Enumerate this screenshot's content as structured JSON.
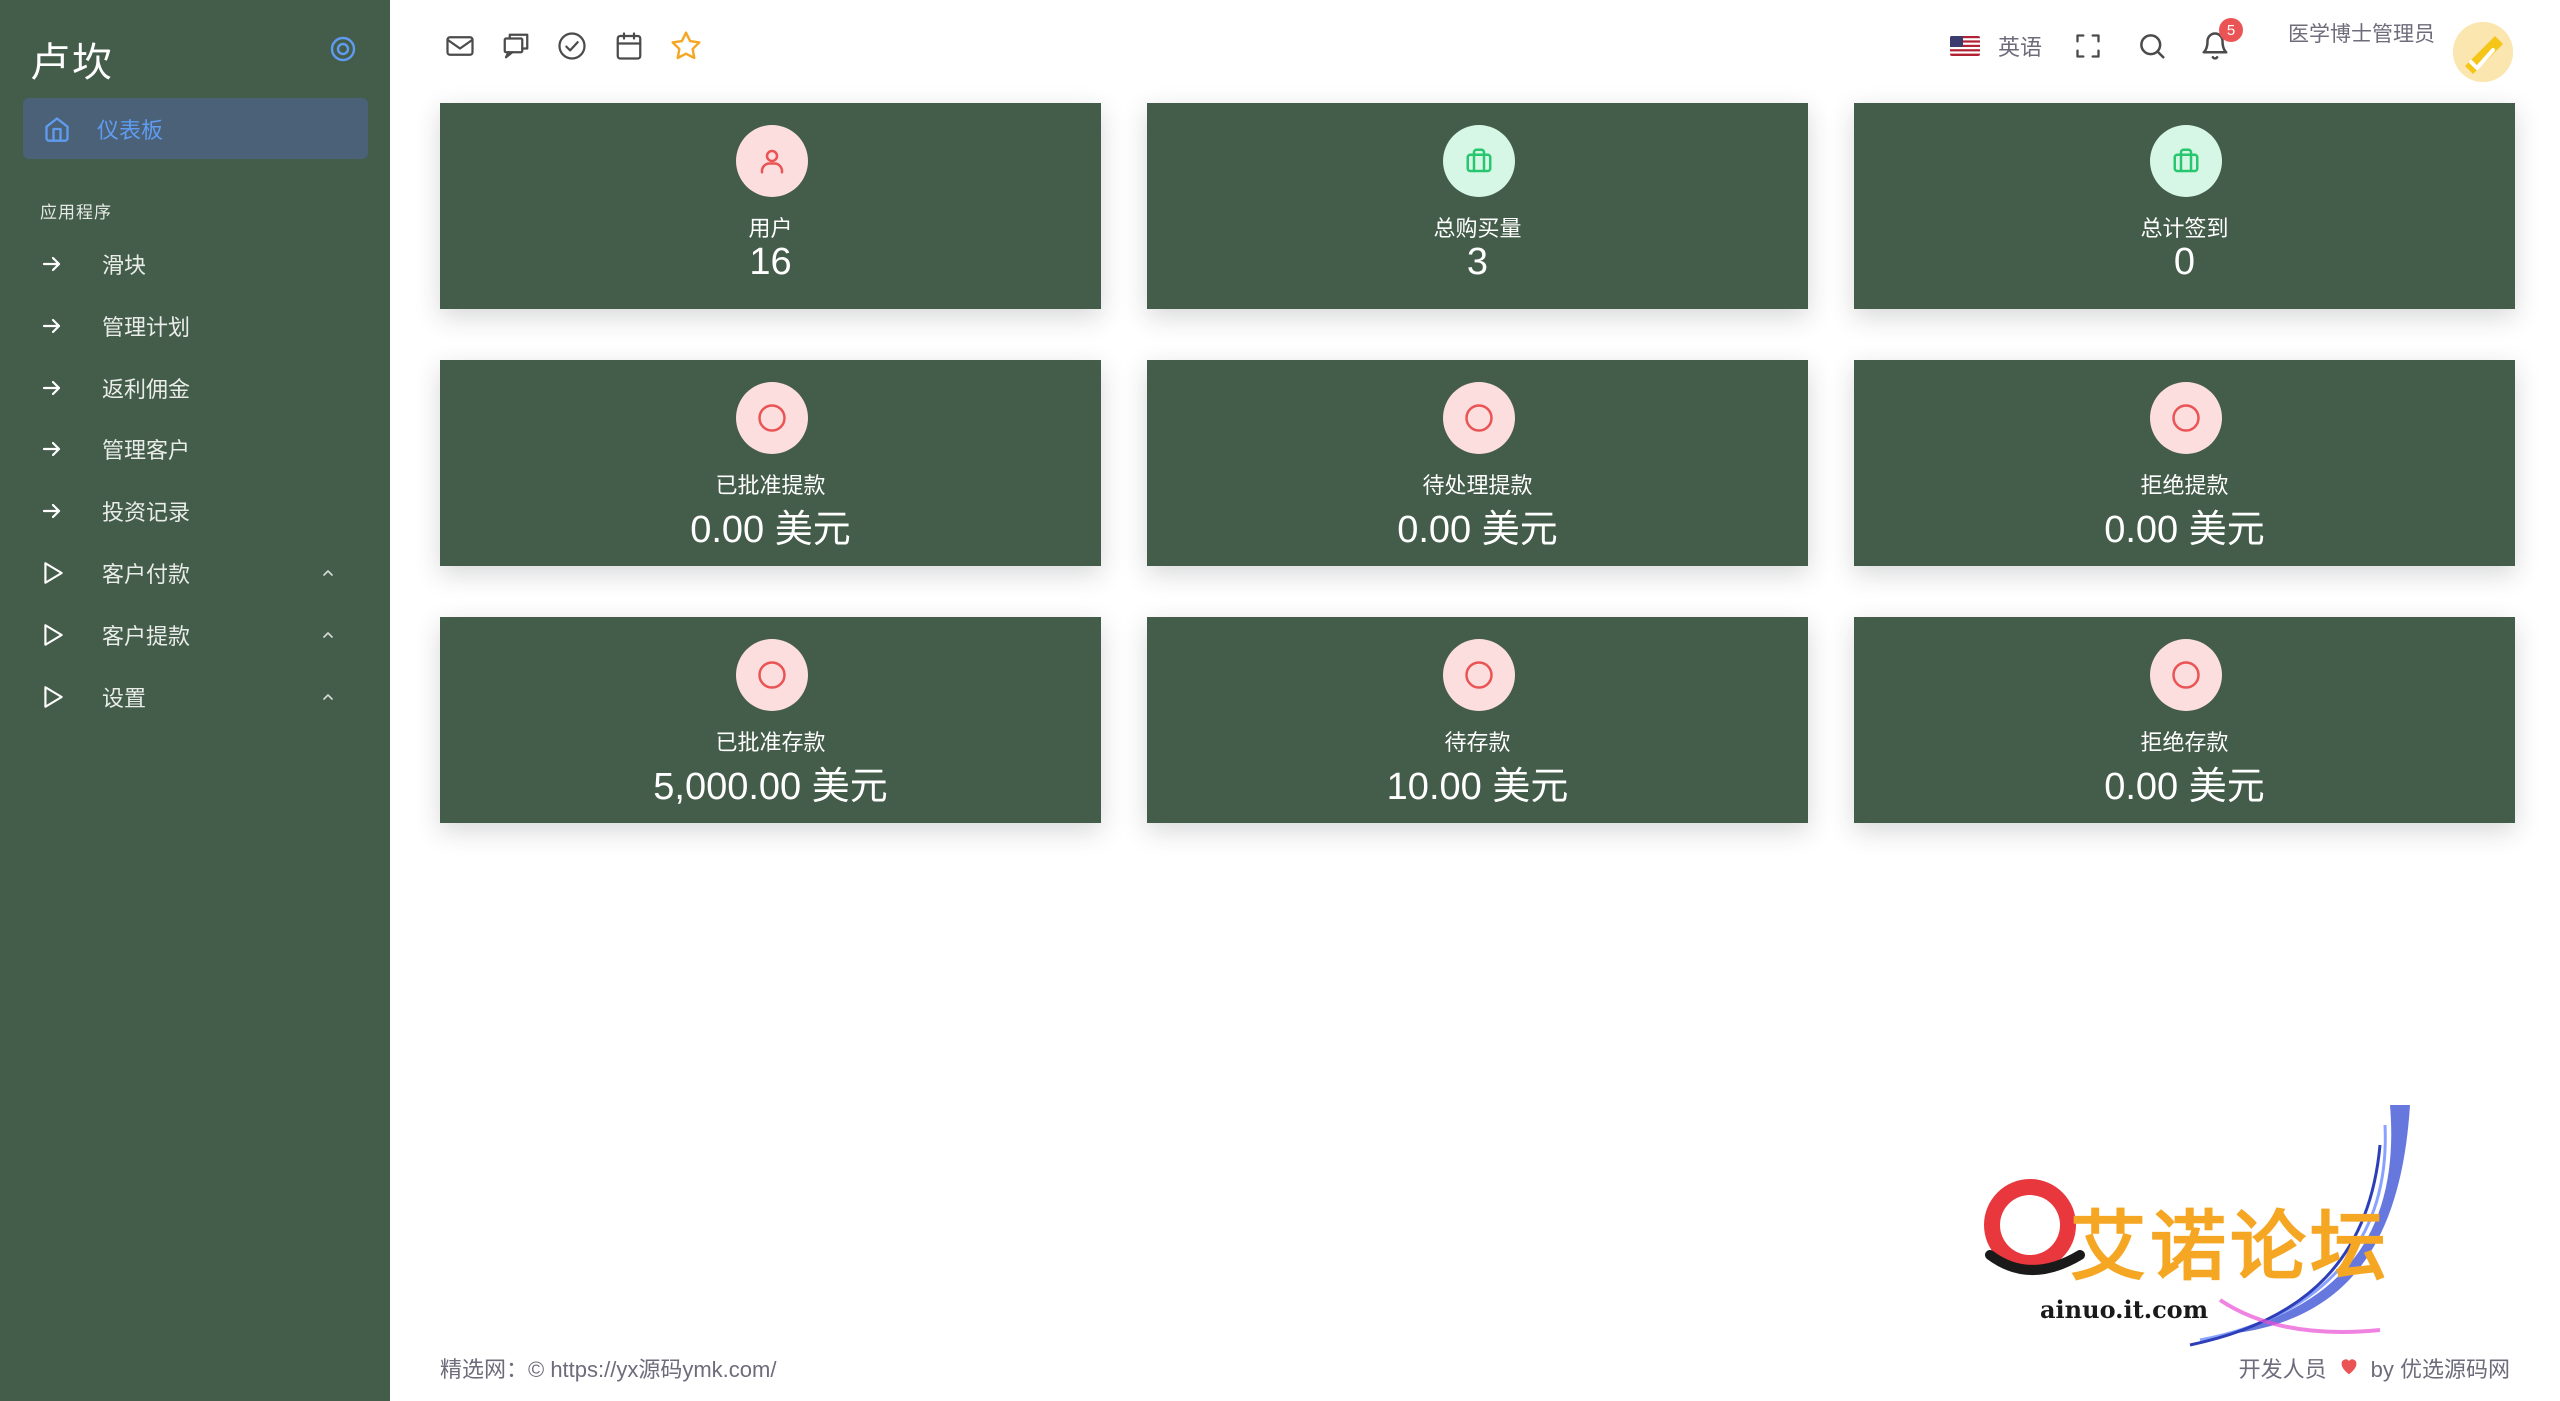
{
  "sidebar": {
    "brand": "卢坎",
    "active_item": "仪表板",
    "section_title": "应用程序",
    "items": [
      {
        "label": "滑块",
        "icon": "arrow-right-icon"
      },
      {
        "label": "管理计划",
        "icon": "arrow-right-icon"
      },
      {
        "label": "返利佣金",
        "icon": "arrow-right-icon"
      },
      {
        "label": "管理客户",
        "icon": "arrow-right-icon"
      },
      {
        "label": "投资记录",
        "icon": "arrow-right-icon"
      },
      {
        "label": "客户付款",
        "icon": "play-icon",
        "expandable": true
      },
      {
        "label": "客户提款",
        "icon": "play-icon",
        "expandable": true
      },
      {
        "label": "设置",
        "icon": "play-icon",
        "expandable": true
      }
    ]
  },
  "header": {
    "shortcut_icons": [
      "mail-icon",
      "chat-icon",
      "check-circle-icon",
      "calendar-icon",
      "star-icon"
    ],
    "language": "英语",
    "notification_count": "5",
    "user_name": "医学博士管理员"
  },
  "cards": [
    {
      "label": "用户",
      "value": "16",
      "icon": "user-icon",
      "tone": "red"
    },
    {
      "label": "总购买量",
      "value": "3",
      "icon": "briefcase-icon",
      "tone": "green"
    },
    {
      "label": "总计签到",
      "value": "0",
      "icon": "briefcase-icon",
      "tone": "green"
    },
    {
      "label": "已批准提款",
      "value": "0.00 美元",
      "icon": "circle-icon",
      "tone": "red"
    },
    {
      "label": "待处理提款",
      "value": "0.00 美元",
      "icon": "circle-icon",
      "tone": "red"
    },
    {
      "label": "拒绝提款",
      "value": "0.00 美元",
      "icon": "circle-icon",
      "tone": "red"
    },
    {
      "label": "已批准存款",
      "value": "5,000.00 美元",
      "icon": "circle-icon",
      "tone": "red"
    },
    {
      "label": "待存款",
      "value": "10.00 美元",
      "icon": "circle-icon",
      "tone": "red"
    },
    {
      "label": "拒绝存款",
      "value": "0.00 美元",
      "icon": "circle-icon",
      "tone": "red"
    }
  ],
  "footer": {
    "left": "精选网：© https://yx源码ymk.com/",
    "right_prefix": "开发人员",
    "right_suffix": "by 优选源码网"
  },
  "watermark": {
    "title": "艾诺论坛",
    "subtitle": "ainuo.it.com"
  },
  "colors": {
    "sidebar_bg": "#445c4a",
    "card_bg": "#445c4a",
    "active_bg": "#4a6178",
    "accent_blue": "#5f9cf0",
    "badge_red": "#ea5455",
    "icon_red": "#ea5455",
    "icon_green": "#28c76f"
  }
}
